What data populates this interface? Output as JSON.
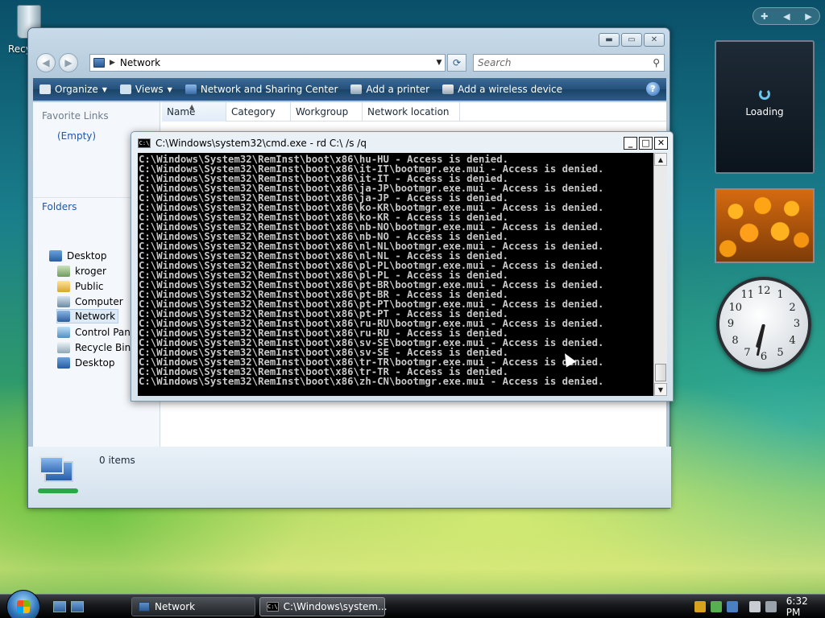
{
  "desktop": {
    "recycle_label": "Recy"
  },
  "explorer": {
    "address": "Network",
    "search_placeholder": "Search",
    "toolbar": {
      "organize": "Organize",
      "views": "Views",
      "network_center": "Network and Sharing Center",
      "add_printer": "Add a printer",
      "add_wireless": "Add a wireless device",
      "help": "?"
    },
    "nav": {
      "favorites_title": "Favorite Links",
      "favorites_empty": "(Empty)",
      "folders_title": "Folders",
      "items": [
        "Desktop",
        "kroger",
        "Public",
        "Computer",
        "Network",
        "Control Pane",
        "Recycle Bin",
        "Desktop"
      ]
    },
    "columns": [
      "Name",
      "Category",
      "Workgroup",
      "Network location"
    ],
    "details": {
      "count": "0 items"
    }
  },
  "cmd": {
    "title": "C:\\Windows\\system32\\cmd.exe - rd  C:\\ /s /q",
    "lines": [
      "C:\\Windows\\System32\\RemInst\\boot\\x86\\hu-HU - Access is denied.",
      "C:\\Windows\\System32\\RemInst\\boot\\x86\\it-IT\\bootmgr.exe.mui - Access is denied.",
      "C:\\Windows\\System32\\RemInst\\boot\\x86\\it-IT - Access is denied.",
      "C:\\Windows\\System32\\RemInst\\boot\\x86\\ja-JP\\bootmgr.exe.mui - Access is denied.",
      "C:\\Windows\\System32\\RemInst\\boot\\x86\\ja-JP - Access is denied.",
      "C:\\Windows\\System32\\RemInst\\boot\\x86\\ko-KR\\bootmgr.exe.mui - Access is denied.",
      "C:\\Windows\\System32\\RemInst\\boot\\x86\\ko-KR - Access is denied.",
      "C:\\Windows\\System32\\RemInst\\boot\\x86\\nb-NO\\bootmgr.exe.mui - Access is denied.",
      "C:\\Windows\\System32\\RemInst\\boot\\x86\\nb-NO - Access is denied.",
      "C:\\Windows\\System32\\RemInst\\boot\\x86\\nl-NL\\bootmgr.exe.mui - Access is denied.",
      "C:\\Windows\\System32\\RemInst\\boot\\x86\\nl-NL - Access is denied.",
      "C:\\Windows\\System32\\RemInst\\boot\\x86\\pl-PL\\bootmgr.exe.mui - Access is denied.",
      "C:\\Windows\\System32\\RemInst\\boot\\x86\\pl-PL - Access is denied.",
      "C:\\Windows\\System32\\RemInst\\boot\\x86\\pt-BR\\bootmgr.exe.mui - Access is denied.",
      "C:\\Windows\\System32\\RemInst\\boot\\x86\\pt-BR - Access is denied.",
      "C:\\Windows\\System32\\RemInst\\boot\\x86\\pt-PT\\bootmgr.exe.mui - Access is denied.",
      "C:\\Windows\\System32\\RemInst\\boot\\x86\\pt-PT - Access is denied.",
      "C:\\Windows\\System32\\RemInst\\boot\\x86\\ru-RU\\bootmgr.exe.mui - Access is denied.",
      "C:\\Windows\\System32\\RemInst\\boot\\x86\\ru-RU - Access is denied.",
      "C:\\Windows\\System32\\RemInst\\boot\\x86\\sv-SE\\bootmgr.exe.mui - Access is denied.",
      "C:\\Windows\\System32\\RemInst\\boot\\x86\\sv-SE - Access is denied.",
      "C:\\Windows\\System32\\RemInst\\boot\\x86\\tr-TR\\bootmgr.exe.mui - Access is denied.",
      "C:\\Windows\\System32\\RemInst\\boot\\x86\\tr-TR - Access is denied.",
      "C:\\Windows\\System32\\RemInst\\boot\\x86\\zh-CN\\bootmgr.exe.mui - Access is denied."
    ]
  },
  "sidebar": {
    "loading_text": "Loading",
    "clock_numbers": [
      "12",
      "1",
      "2",
      "3",
      "4",
      "5",
      "6",
      "7",
      "8",
      "9",
      "10",
      "11"
    ]
  },
  "taskbar": {
    "buttons": [
      "Network",
      "C:\\Windows\\system..."
    ],
    "time": "6:32 PM"
  },
  "colors": {
    "accent": "#24507a",
    "console_bg": "#000000",
    "console_text": "#c8c8c8"
  }
}
